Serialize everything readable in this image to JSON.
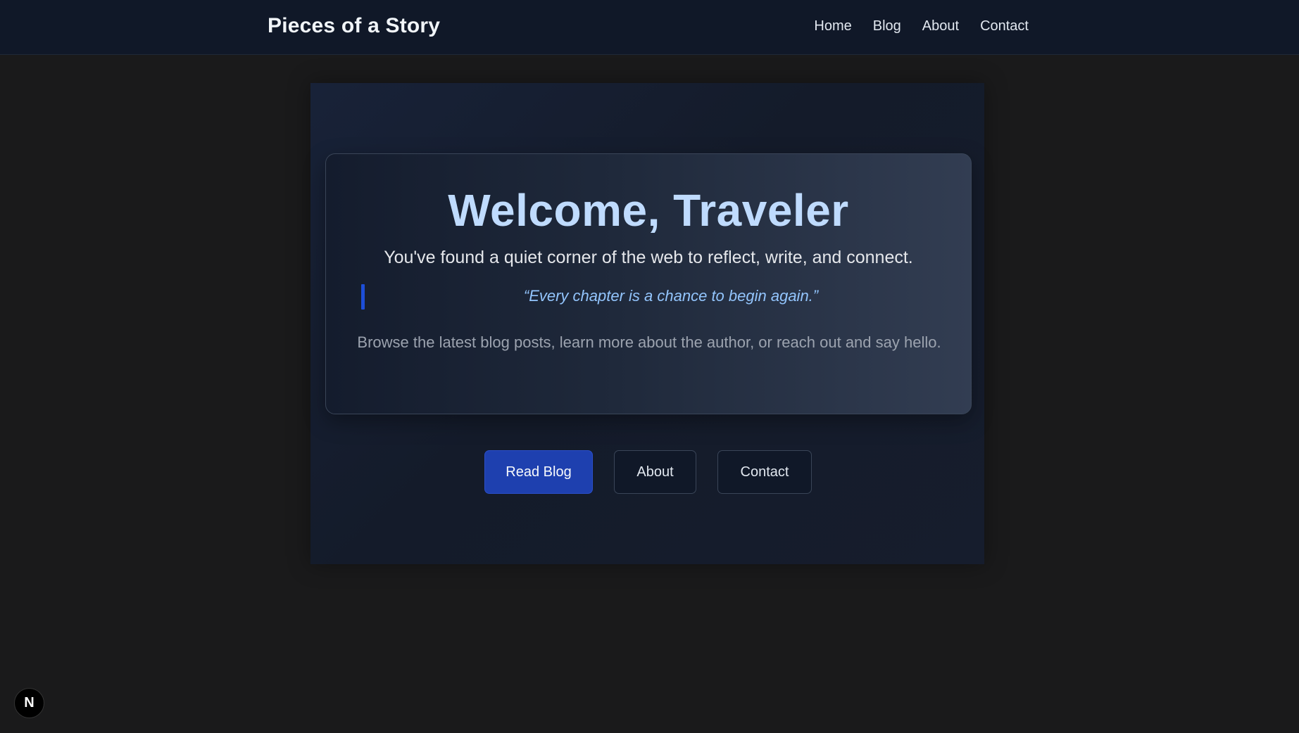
{
  "header": {
    "brand": "Pieces of a Story",
    "nav": [
      "Home",
      "Blog",
      "About",
      "Contact"
    ]
  },
  "hero": {
    "title": "Welcome, Traveler",
    "subtitle": "You've found a quiet corner of the web to reflect, write, and connect.",
    "quote": "“Every chapter is a chance to begin again.”",
    "body": "Browse the latest blog posts, learn more about the author, or reach out and say hello."
  },
  "actions": {
    "read_blog": "Read Blog",
    "about": "About",
    "contact": "Contact"
  },
  "badge": {
    "label": "N"
  },
  "colors": {
    "accent": "#1e40af",
    "title": "#bfdbfe",
    "quote": "#93c5fd"
  }
}
